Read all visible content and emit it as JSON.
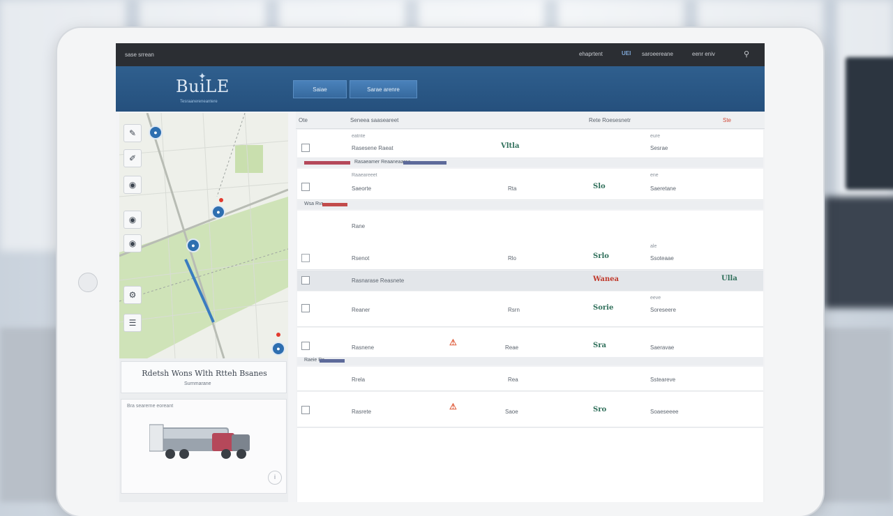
{
  "topbar": {
    "left": "sase srrean",
    "items": [
      "ehaprtent",
      "UEI",
      "saroeereane",
      "eenr eniv"
    ],
    "search_icon": "search-icon"
  },
  "header": {
    "logo": "BuiLE",
    "logo_sub": "Tesraanereneantere",
    "buttons": [
      "Saiae",
      "Sarae arenre"
    ]
  },
  "map_tools": [
    "pen-icon",
    "pencil-icon",
    "eye-icon",
    "pin-icon",
    "pin-icon",
    "settings-icon",
    "layers-icon"
  ],
  "route_card": {
    "title": "Rdetsh Wons Wlth Rtteh Bsanes",
    "sub": "Surnmarane"
  },
  "truck_card": {
    "caption": "Bra searerne eoreant",
    "info_icon": "info-icon"
  },
  "table": {
    "headers": [
      "Ote",
      "Seneea saaseareet",
      "Rete Roesesnetr",
      "Ste"
    ],
    "rows": [
      {
        "name": "Rasesene Raeat",
        "sub": "eatnte",
        "chip": "Vltla",
        "val": "",
        "right": "Sesrae",
        "rsub": "eure"
      },
      {
        "name": "Saeorte",
        "sub": "Raaeareeet",
        "chip": "Slo",
        "val": "Rta",
        "right": "Saeretane",
        "rsub": "ene"
      },
      {
        "name": "Rsenot",
        "sub": "Rane",
        "chip": "Srlo",
        "val": "Rlo",
        "right": "Ssoteaae",
        "rsub": "ale"
      },
      {
        "name": "Rasnarase Reasnete",
        "sub": "",
        "chip": "Wanea",
        "val": "",
        "right": "Ulla",
        "rsub": ""
      },
      {
        "name": "Reaner",
        "sub": "",
        "chip": "Sorie",
        "val": "Rsrn",
        "right": "Soreseere",
        "rsub": "eeve"
      },
      {
        "name": "Rasnene",
        "sub": "",
        "chip": "Sra",
        "val": "Reae",
        "right": "Saeravae",
        "rsub": ""
      },
      {
        "name": "Rrela",
        "sub": "",
        "chip": "",
        "val": "Rea",
        "right": "Ssteareve",
        "rsub": ""
      },
      {
        "name": "Rasrete",
        "sub": "",
        "chip": "Sro",
        "val": "Saoe",
        "right": "Soaeseeee",
        "rsub": ""
      }
    ],
    "groups": [
      {
        "label": "Rasaeamer Reaaneaaree"
      },
      {
        "label": "Wsa  Rvr"
      },
      {
        "label": "Raeie  Re"
      }
    ]
  },
  "colors": {
    "header": "#2b5a89",
    "topbar": "#2b2e33",
    "accent": "#4a82bb",
    "alert": "#e06040",
    "chip": "#2f6f5a"
  }
}
